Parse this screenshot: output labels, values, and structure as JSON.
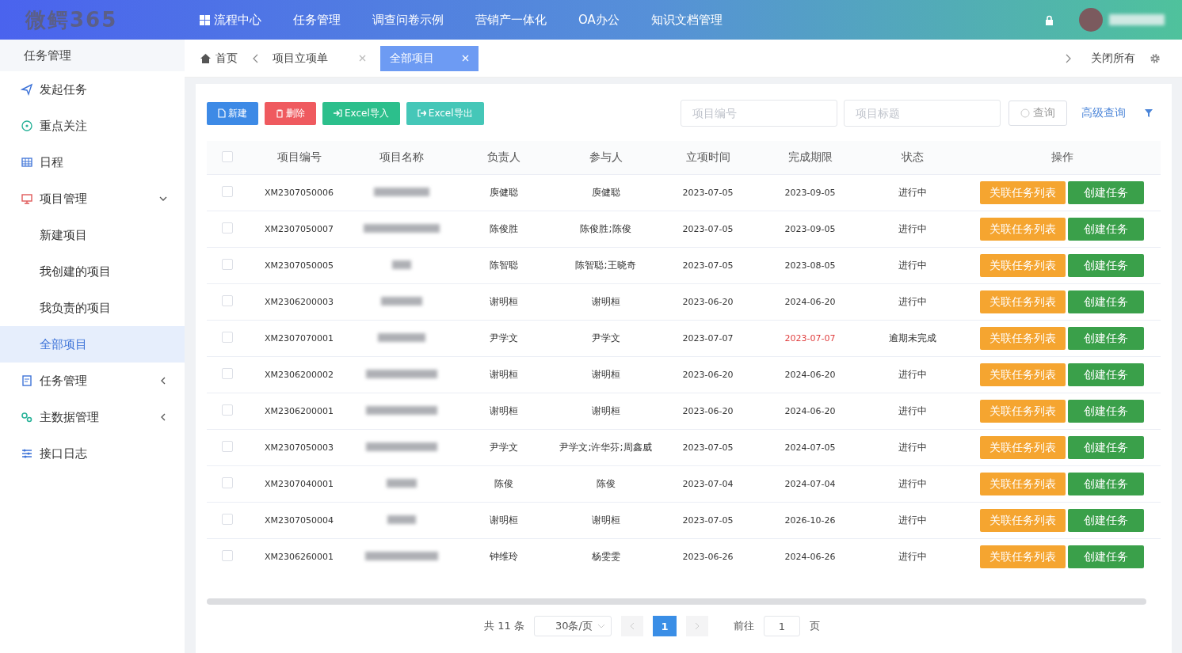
{
  "header": {
    "logo": "微鳄365",
    "nav": [
      {
        "label": "流程中心",
        "kind": "grid"
      },
      {
        "label": "任务管理",
        "kind": "plain"
      },
      {
        "label": "调查问卷示例",
        "kind": "plain"
      },
      {
        "label": "营销产一体化",
        "kind": "plain"
      },
      {
        "label": "OA办公",
        "kind": "plain"
      },
      {
        "label": "知识文档管理",
        "kind": "plain"
      }
    ]
  },
  "sidebar": {
    "title": "任务管理",
    "items": [
      {
        "label": "发起任务",
        "kind": "send",
        "selected": false
      },
      {
        "label": "重点关注",
        "kind": "target",
        "selected": false
      },
      {
        "label": "日程",
        "kind": "table",
        "selected": false
      },
      {
        "label": "项目管理",
        "kind": "monitor",
        "selected": false,
        "expanded": true,
        "children": [
          {
            "label": "新建项目",
            "selected": false
          },
          {
            "label": "我创建的项目",
            "selected": false
          },
          {
            "label": "我负责的项目",
            "selected": false
          },
          {
            "label": "全部项目",
            "selected": true
          }
        ]
      },
      {
        "label": "任务管理",
        "kind": "doc",
        "selected": false,
        "expanded": false
      },
      {
        "label": "主数据管理",
        "kind": "gears",
        "selected": false,
        "expanded": false
      },
      {
        "label": "接口日志",
        "kind": "sliders",
        "selected": false
      }
    ]
  },
  "tabs": [
    {
      "label": "首页",
      "kind": "home",
      "selected": false
    },
    {
      "label": "项目立项单",
      "kind": "closable",
      "selected": false
    },
    {
      "label": "全部项目",
      "kind": "closable",
      "selected": true
    }
  ],
  "tab_actions": {
    "close_all": "关闭所有"
  },
  "toolbar": {
    "buttons": [
      {
        "label": "新建",
        "kind": "new"
      },
      {
        "label": "删除",
        "kind": "delete"
      },
      {
        "label": "Excel导入",
        "kind": "import"
      },
      {
        "label": "Excel导出",
        "kind": "export"
      }
    ],
    "search": [
      {
        "placeholder": "项目编号"
      },
      {
        "placeholder": "项目标题"
      }
    ],
    "query": "查询",
    "advanced": "高级查询"
  },
  "table": {
    "header_checked": false,
    "columns": [
      "项目编号",
      "项目名称",
      "负责人",
      "参与人",
      "立项时间",
      "完成期限",
      "状态",
      "操作"
    ],
    "rows": [
      {
        "checked": false,
        "code": "XM2307050006",
        "owner": "庾健聪",
        "participants": "庾健聪",
        "start": "2023-07-05",
        "due": "2023-09-05",
        "overdue": false,
        "status": "进行中",
        "actions": [
          "关联任务列表",
          "创建任务"
        ]
      },
      {
        "checked": false,
        "code": "XM2307050007",
        "owner": "陈俊胜",
        "participants": "陈俊胜;陈俊",
        "start": "2023-07-05",
        "due": "2023-09-05",
        "overdue": false,
        "status": "进行中",
        "actions": [
          "关联任务列表",
          "创建任务"
        ]
      },
      {
        "checked": false,
        "code": "XM2307050005",
        "owner": "陈智聪",
        "participants": "陈智聪;王晓奇",
        "start": "2023-07-05",
        "due": "2023-08-05",
        "overdue": false,
        "status": "进行中",
        "actions": [
          "关联任务列表",
          "创建任务"
        ]
      },
      {
        "checked": false,
        "code": "XM2306200003",
        "owner": "谢明桓",
        "participants": "谢明桓",
        "start": "2023-06-20",
        "due": "2024-06-20",
        "overdue": false,
        "status": "进行中",
        "actions": [
          "关联任务列表",
          "创建任务"
        ]
      },
      {
        "checked": false,
        "code": "XM2307070001",
        "owner": "尹学文",
        "participants": "尹学文",
        "start": "2023-07-07",
        "due": "2023-07-07",
        "overdue": true,
        "status": "逾期未完成",
        "actions": [
          "关联任务列表",
          "创建任务"
        ]
      },
      {
        "checked": false,
        "code": "XM2306200002",
        "owner": "谢明桓",
        "participants": "谢明桓",
        "start": "2023-06-20",
        "due": "2024-06-20",
        "overdue": false,
        "status": "进行中",
        "actions": [
          "关联任务列表",
          "创建任务"
        ]
      },
      {
        "checked": false,
        "code": "XM2306200001",
        "owner": "谢明桓",
        "participants": "谢明桓",
        "start": "2023-06-20",
        "due": "2024-06-20",
        "overdue": false,
        "status": "进行中",
        "actions": [
          "关联任务列表",
          "创建任务"
        ]
      },
      {
        "checked": false,
        "code": "XM2307050003",
        "owner": "尹学文",
        "participants": "尹学文;许华芬;周鑫威",
        "start": "2023-07-05",
        "due": "2024-07-05",
        "overdue": false,
        "status": "进行中",
        "actions": [
          "关联任务列表",
          "创建任务"
        ]
      },
      {
        "checked": false,
        "code": "XM2307040001",
        "owner": "陈俊",
        "participants": "陈俊",
        "start": "2023-07-04",
        "due": "2024-07-04",
        "overdue": false,
        "status": "进行中",
        "actions": [
          "关联任务列表",
          "创建任务"
        ]
      },
      {
        "checked": false,
        "code": "XM2307050004",
        "owner": "谢明桓",
        "participants": "谢明桓",
        "start": "2023-07-05",
        "due": "2026-10-26",
        "overdue": false,
        "status": "进行中",
        "actions": [
          "关联任务列表",
          "创建任务"
        ]
      },
      {
        "checked": false,
        "code": "XM2306260001",
        "owner": "钟维玲",
        "participants": "杨雯雯",
        "start": "2023-06-26",
        "due": "2024-06-26",
        "overdue": false,
        "status": "进行中",
        "actions": [
          "关联任务列表",
          "创建任务"
        ]
      }
    ]
  },
  "pagination": {
    "total": "共 11 条",
    "page_size": "30条/页",
    "pages": [
      {
        "label": "1",
        "selected": true
      }
    ],
    "goto_label": "前往",
    "goto_value": "1",
    "goto_suffix": "页"
  }
}
